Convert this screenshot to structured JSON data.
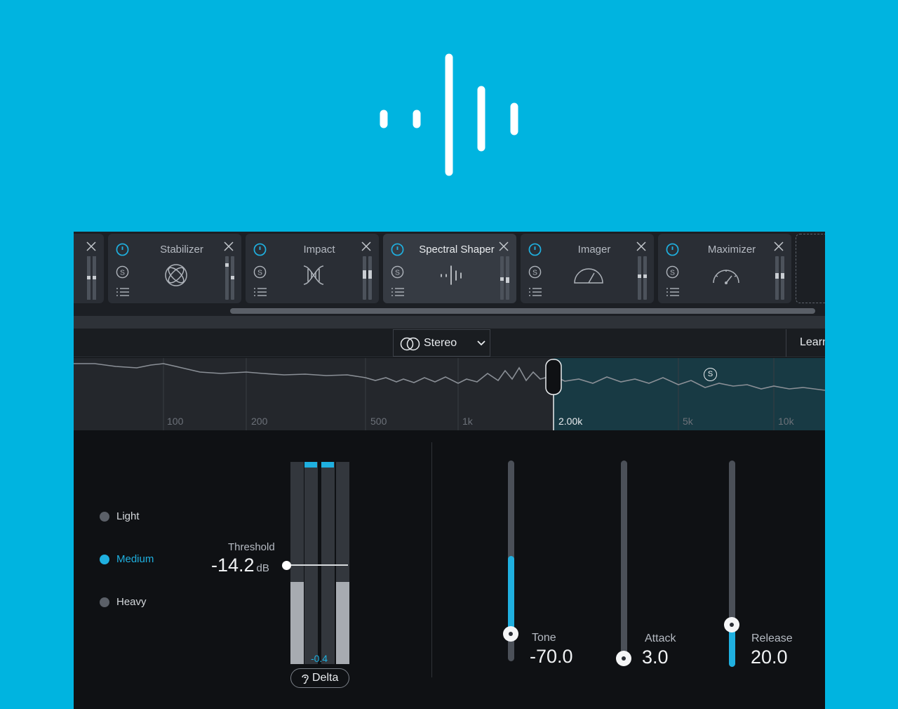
{
  "hero": {
    "icon": "spectral-shaper-logo-icon",
    "accent": "#00b4e0"
  },
  "chain": {
    "modules": [
      {
        "name": "Stabilizer",
        "icon": "stabilizer-icon"
      },
      {
        "name": "Impact",
        "icon": "impact-icon"
      },
      {
        "name": "Spectral Shaper",
        "icon": "spectral-shaper-icon"
      },
      {
        "name": "Imager",
        "icon": "imager-icon"
      },
      {
        "name": "Maximizer",
        "icon": "maximizer-icon"
      }
    ],
    "active_module": "Spectral Shaper"
  },
  "toolbar": {
    "stereo_label": "Stereo",
    "learn_label": "Learn"
  },
  "spectrum": {
    "freq_labels": [
      "100",
      "200",
      "500",
      "1k",
      "2.00k",
      "5k",
      "10k"
    ],
    "selected_freq": "2.00k",
    "solo_badge": "S"
  },
  "modes": {
    "items": [
      "Light",
      "Medium",
      "Heavy"
    ],
    "selected": "Medium"
  },
  "threshold": {
    "label": "Threshold",
    "value": "-14.2",
    "unit": "dB",
    "delta_value": "-0.4",
    "delta_label": "Delta"
  },
  "params": {
    "tone": {
      "label": "Tone",
      "value": "-70.0"
    },
    "attack": {
      "label": "Attack",
      "value": "3.0"
    },
    "release": {
      "label": "Release",
      "value": "20.0"
    }
  },
  "colors": {
    "accent": "#1fb0e0",
    "background": "#0f1114"
  }
}
